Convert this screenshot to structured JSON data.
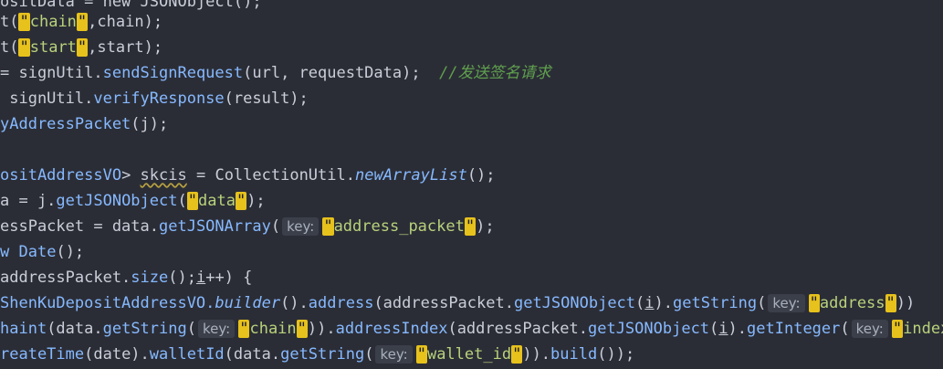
{
  "lines": [
    [
      {
        "c": "plain",
        "t": "ositData = new JSONObject();"
      }
    ],
    [
      {
        "c": "plain",
        "t": "t("
      },
      {
        "c": "q",
        "t": "\""
      },
      {
        "c": "str",
        "t": "chain"
      },
      {
        "c": "q",
        "t": "\""
      },
      {
        "c": "plain",
        "t": ",chain);"
      }
    ],
    [
      {
        "c": "plain",
        "t": "t("
      },
      {
        "c": "q",
        "t": "\""
      },
      {
        "c": "str",
        "t": "start"
      },
      {
        "c": "q",
        "t": "\""
      },
      {
        "c": "plain",
        "t": ",start);"
      }
    ],
    [
      {
        "c": "plain",
        "t": "= signUtil."
      },
      {
        "c": "method",
        "t": "sendSignRequest"
      },
      {
        "c": "plain",
        "t": "(url, requestData);  "
      },
      {
        "c": "comment",
        "t": "//发送签名请求"
      }
    ],
    [
      {
        "c": "plain",
        "t": " signUtil."
      },
      {
        "c": "method",
        "t": "verifyResponse"
      },
      {
        "c": "plain",
        "t": "(result);"
      }
    ],
    [
      {
        "c": "method",
        "t": "yAddressPacket"
      },
      {
        "c": "plain",
        "t": "(j);"
      }
    ],
    [
      {
        "c": "plain",
        "t": ""
      }
    ],
    [
      {
        "c": "type",
        "t": "ositAddressVO"
      },
      {
        "c": "plain",
        "t": "> "
      },
      {
        "c": "squig",
        "t": "skcis"
      },
      {
        "c": "plain",
        "t": " = "
      },
      {
        "c": "cls",
        "t": "CollectionUtil."
      },
      {
        "c": "ital",
        "t": "newArrayList"
      },
      {
        "c": "plain",
        "t": "();"
      }
    ],
    [
      {
        "c": "plain",
        "t": "a = j."
      },
      {
        "c": "method",
        "t": "getJSONObject"
      },
      {
        "c": "plain",
        "t": "("
      },
      {
        "c": "q",
        "t": "\""
      },
      {
        "c": "str",
        "t": "data"
      },
      {
        "c": "q",
        "t": "\""
      },
      {
        "c": "plain",
        "t": ");"
      }
    ],
    [
      {
        "c": "plain",
        "t": "essPacket = data."
      },
      {
        "c": "method",
        "t": "getJSONArray"
      },
      {
        "c": "plain",
        "t": "("
      },
      {
        "c": "hint",
        "t": "key:"
      },
      {
        "c": "q",
        "t": "\""
      },
      {
        "c": "str",
        "t": "address_packet"
      },
      {
        "c": "q",
        "t": "\""
      },
      {
        "c": "plain",
        "t": ");"
      }
    ],
    [
      {
        "c": "kw",
        "t": "w"
      },
      {
        "c": "plain",
        "t": " "
      },
      {
        "c": "type",
        "t": "Date"
      },
      {
        "c": "plain",
        "t": "();"
      }
    ],
    [
      {
        "c": "plain",
        "t": "addressPacket."
      },
      {
        "c": "method",
        "t": "size"
      },
      {
        "c": "plain",
        "t": "();"
      },
      {
        "c": "uline",
        "t": "i"
      },
      {
        "c": "plain",
        "t": "++) {"
      }
    ],
    [
      {
        "c": "type",
        "t": "ShenKuDepositAddressVO."
      },
      {
        "c": "ital",
        "t": "builder"
      },
      {
        "c": "plain",
        "t": "()."
      },
      {
        "c": "method",
        "t": "address"
      },
      {
        "c": "plain",
        "t": "(addressPacket."
      },
      {
        "c": "method",
        "t": "getJSONObject"
      },
      {
        "c": "plain",
        "t": "("
      },
      {
        "c": "uline",
        "t": "i"
      },
      {
        "c": "plain",
        "t": ")."
      },
      {
        "c": "method",
        "t": "getString"
      },
      {
        "c": "plain",
        "t": "("
      },
      {
        "c": "hint",
        "t": "key:"
      },
      {
        "c": "q",
        "t": "\""
      },
      {
        "c": "str",
        "t": "address"
      },
      {
        "c": "q",
        "t": "\""
      },
      {
        "c": "plain",
        "t": "))"
      }
    ],
    [
      {
        "c": "method",
        "t": "haint"
      },
      {
        "c": "plain",
        "t": "(data."
      },
      {
        "c": "method",
        "t": "getString"
      },
      {
        "c": "plain",
        "t": "("
      },
      {
        "c": "hint",
        "t": "key:"
      },
      {
        "c": "q",
        "t": "\""
      },
      {
        "c": "str",
        "t": "chain"
      },
      {
        "c": "q",
        "t": "\""
      },
      {
        "c": "plain",
        "t": "))."
      },
      {
        "c": "method",
        "t": "addressIndex"
      },
      {
        "c": "plain",
        "t": "(addressPacket."
      },
      {
        "c": "method",
        "t": "getJSONObject"
      },
      {
        "c": "plain",
        "t": "("
      },
      {
        "c": "uline",
        "t": "i"
      },
      {
        "c": "plain",
        "t": ")."
      },
      {
        "c": "method",
        "t": "getInteger"
      },
      {
        "c": "plain",
        "t": "("
      },
      {
        "c": "hint",
        "t": "key:"
      },
      {
        "c": "q",
        "t": "\""
      },
      {
        "c": "str",
        "t": "index"
      },
      {
        "c": "q",
        "t": "\""
      },
      {
        "c": "plain",
        "t": "))"
      }
    ],
    [
      {
        "c": "method",
        "t": "reateTime"
      },
      {
        "c": "plain",
        "t": "(date)."
      },
      {
        "c": "method",
        "t": "walletId"
      },
      {
        "c": "plain",
        "t": "(data."
      },
      {
        "c": "method",
        "t": "getString"
      },
      {
        "c": "plain",
        "t": "("
      },
      {
        "c": "hint",
        "t": "key:"
      },
      {
        "c": "q",
        "t": "\""
      },
      {
        "c": "str",
        "t": "wallet_id"
      },
      {
        "c": "q",
        "t": "\""
      },
      {
        "c": "plain",
        "t": "))."
      },
      {
        "c": "method",
        "t": "build"
      },
      {
        "c": "plain",
        "t": "());"
      }
    ]
  ]
}
